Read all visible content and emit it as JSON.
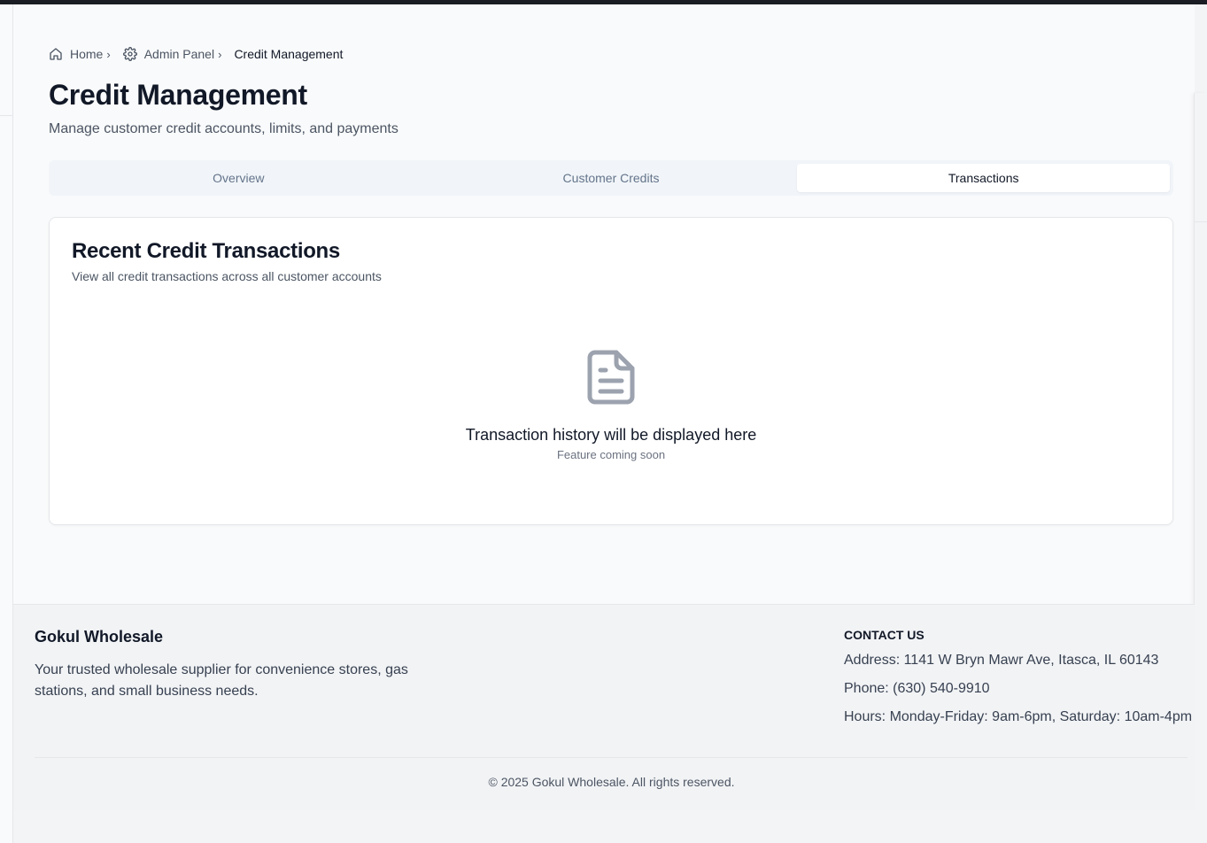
{
  "breadcrumb": {
    "home": "Home",
    "admin": "Admin Panel",
    "current": "Credit Management"
  },
  "header": {
    "title": "Credit Management",
    "subtitle": "Manage customer credit accounts, limits, and payments"
  },
  "tabs": [
    {
      "label": "Overview",
      "active": false
    },
    {
      "label": "Customer Credits",
      "active": false
    },
    {
      "label": "Transactions",
      "active": true
    }
  ],
  "card": {
    "title": "Recent Credit Transactions",
    "description": "View all credit transactions across all customer accounts",
    "empty_title": "Transaction history will be displayed here",
    "empty_subtitle": "Feature coming soon",
    "icon": "file-text-icon"
  },
  "footer": {
    "brand": "Gokul Wholesale",
    "tagline": "Your trusted wholesale supplier for convenience stores, gas stations, and small business needs.",
    "contact_heading": "CONTACT US",
    "address": "Address: 1141 W Bryn Mawr Ave, Itasca, IL 60143",
    "phone": "Phone: (630) 540-9910",
    "hours": "Hours: Monday-Friday: 9am-6pm, Saturday: 10am-4pm",
    "copyright": "© 2025 Gokul Wholesale. All rights reserved."
  },
  "colors": {
    "text_primary": "#111827",
    "text_muted": "#4b5563",
    "tab_bg": "#f1f5f9",
    "icon_gray": "#9ca3af"
  }
}
